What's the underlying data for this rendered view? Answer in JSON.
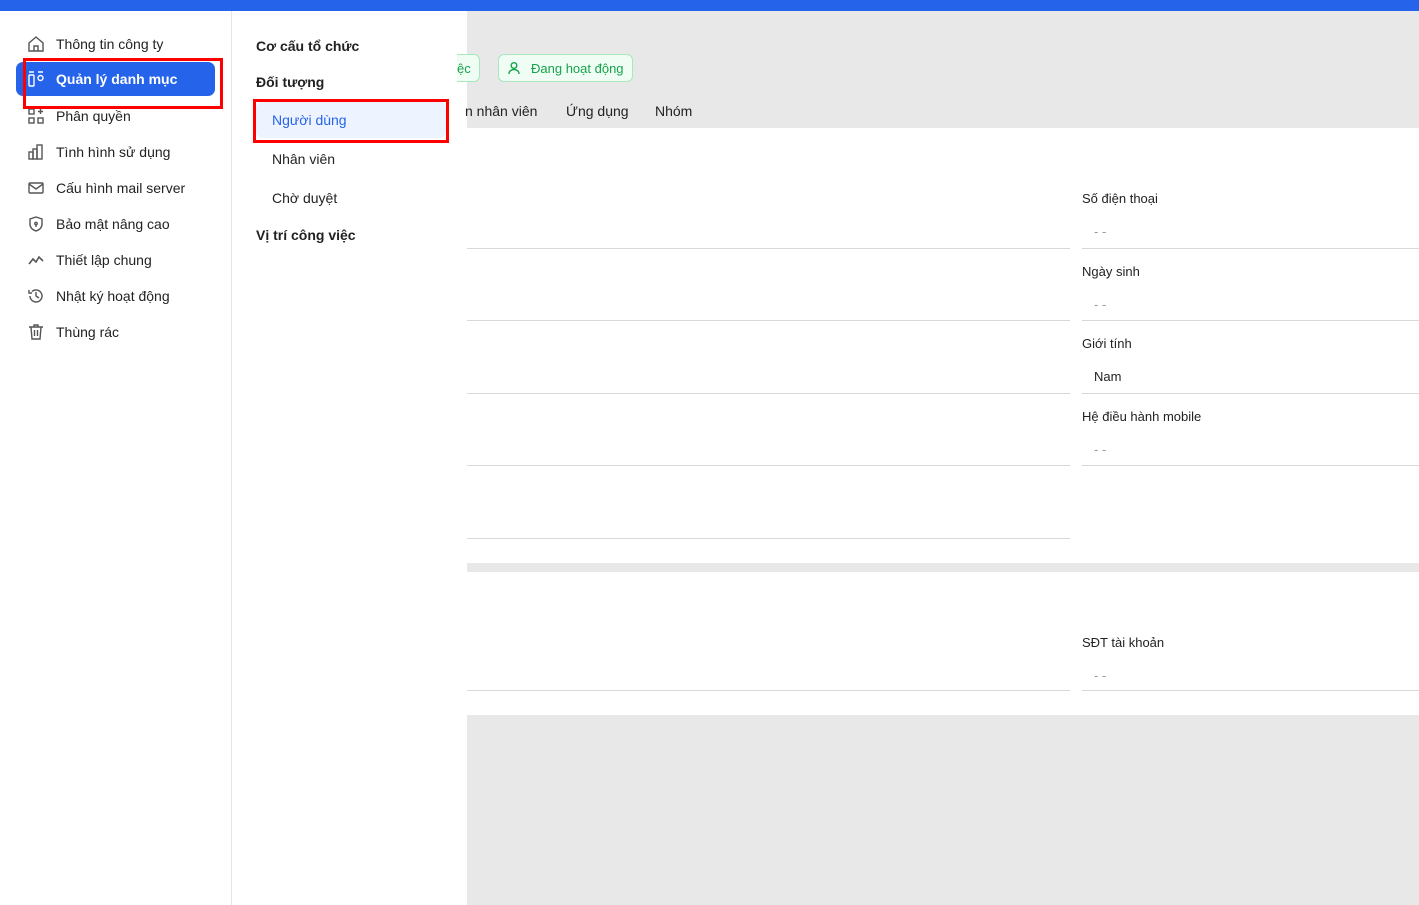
{
  "sidebar": {
    "items": [
      {
        "label": "Thông tin công ty",
        "icon": "home-icon"
      },
      {
        "label": "Quản lý danh mục",
        "icon": "catalog-icon",
        "active": true
      },
      {
        "label": "Phân quyền",
        "icon": "grid-plus-icon"
      },
      {
        "label": "Tình hình sử dụng",
        "icon": "bar-chart-icon"
      },
      {
        "label": "Cấu hình mail server",
        "icon": "mail-icon"
      },
      {
        "label": "Bảo mật nâng cao",
        "icon": "shield-icon"
      },
      {
        "label": "Thiết lập chung",
        "icon": "trend-icon"
      },
      {
        "label": "Nhật ký hoạt động",
        "icon": "history-icon"
      },
      {
        "label": "Thùng rác",
        "icon": "trash-icon"
      }
    ]
  },
  "submenu": {
    "org": "Cơ cấu tổ chức",
    "objects": "Đối tượng",
    "users": "Người dùng",
    "employees": "Nhân viên",
    "pending": "Chờ duyệt",
    "positions": "Vị trí công việc"
  },
  "main": {
    "chip_partial": "ệc",
    "status": "Đang hoạt động",
    "tabs": [
      "n nhân viên",
      "Ứng dụng",
      "Nhóm"
    ],
    "fields": [
      {
        "label": "Số điện thoại",
        "value": "- -"
      },
      {
        "label": "Ngày sinh",
        "value": "- -"
      },
      {
        "label": "Giới tính",
        "value": "Nam"
      },
      {
        "label": "Hệ điều hành mobile",
        "value": "- -"
      }
    ],
    "account_field": {
      "label": "SĐT tài khoản",
      "value": "- -"
    }
  },
  "colors": {
    "accent": "#2563eb",
    "success": "#16a34a",
    "highlight": "#ff0000"
  }
}
